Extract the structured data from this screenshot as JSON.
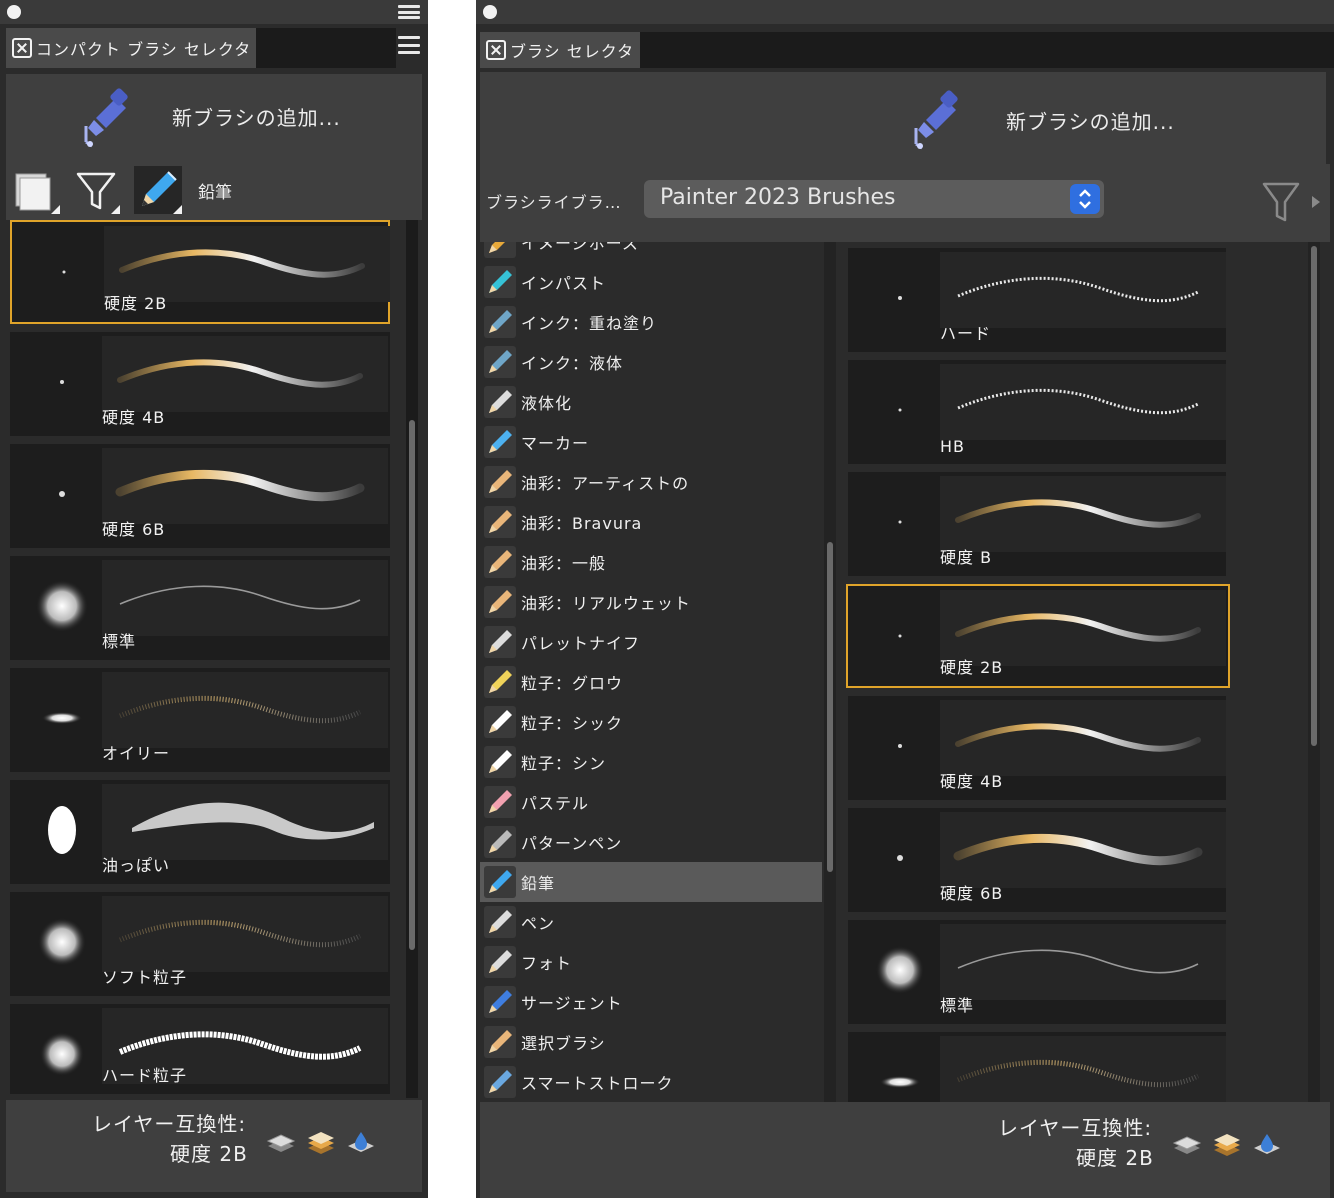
{
  "left_panel": {
    "tab_title": "コンパクト ブラシ セレクタ",
    "add_brush_label": "新ブラシの追加...",
    "current_variant": "鉛筆",
    "brushes": [
      {
        "label": "硬度 2B",
        "selected": true
      },
      {
        "label": "硬度 4B",
        "selected": false
      },
      {
        "label": "硬度 6B",
        "selected": false
      },
      {
        "label": "標準",
        "selected": false
      },
      {
        "label": "オイリー",
        "selected": false
      },
      {
        "label": "油っぽい",
        "selected": false
      },
      {
        "label": "ソフト粒子",
        "selected": false
      },
      {
        "label": "ハード粒子",
        "selected": false
      }
    ],
    "layer_compat_title": "レイヤー互換性:",
    "layer_compat_value": "硬度 2B"
  },
  "right_panel": {
    "tab_title": "ブラシ セレクタ",
    "add_brush_label": "新ブラシの追加...",
    "library_label": "ブラシライブラ…",
    "library_value": "Painter 2023 Brushes",
    "categories": [
      {
        "label": "イメージホース",
        "icon": "image-hose-icon"
      },
      {
        "label": "インパスト",
        "icon": "impasto-icon"
      },
      {
        "label": "インク：重ね塗り",
        "icon": "ink-bottle-icon"
      },
      {
        "label": "インク：液体",
        "icon": "ink-liquid-icon"
      },
      {
        "label": "液体化",
        "icon": "liquify-icon"
      },
      {
        "label": "マーカー",
        "icon": "marker-icon"
      },
      {
        "label": "油彩：アーティストの",
        "icon": "oil-brush-icon"
      },
      {
        "label": "油彩：Bravura",
        "icon": "oil-brush-icon"
      },
      {
        "label": "油彩：一般",
        "icon": "oil-brush-icon"
      },
      {
        "label": "油彩：リアルウェット",
        "icon": "oil-brush-icon"
      },
      {
        "label": "パレットナイフ",
        "icon": "palette-knife-icon"
      },
      {
        "label": "粒子：グロウ",
        "icon": "particle-glow-icon"
      },
      {
        "label": "粒子：シック",
        "icon": "particle-thick-icon"
      },
      {
        "label": "粒子：シン",
        "icon": "particle-thin-icon"
      },
      {
        "label": "パステル",
        "icon": "pastel-icon"
      },
      {
        "label": "パターンペン",
        "icon": "pattern-pen-icon"
      },
      {
        "label": "鉛筆",
        "icon": "pencil-icon",
        "selected": true
      },
      {
        "label": "ペン",
        "icon": "pen-icon"
      },
      {
        "label": "フォト",
        "icon": "photo-icon"
      },
      {
        "label": "サージェント",
        "icon": "sargent-brush-icon"
      },
      {
        "label": "選択ブラシ",
        "icon": "selection-brush-icon"
      },
      {
        "label": "スマートストローク",
        "icon": "smart-stroke-icon"
      }
    ],
    "brushes": [
      {
        "label": "ハード",
        "selected": false
      },
      {
        "label": "HB",
        "selected": false
      },
      {
        "label": "硬度 B",
        "selected": false
      },
      {
        "label": "硬度 2B",
        "selected": true
      },
      {
        "label": "硬度 4B",
        "selected": false
      },
      {
        "label": "硬度 6B",
        "selected": false
      },
      {
        "label": "標準",
        "selected": false
      },
      {
        "label": "",
        "selected": false
      }
    ],
    "layer_compat_title": "レイヤー互換性:",
    "layer_compat_value": "硬度 2B"
  },
  "colors": {
    "panel_bg": "#2b2b2b",
    "selection_border": "#e0a42a",
    "item_bg": "#1d1d1d",
    "select_accent": "#2f6fe0"
  }
}
